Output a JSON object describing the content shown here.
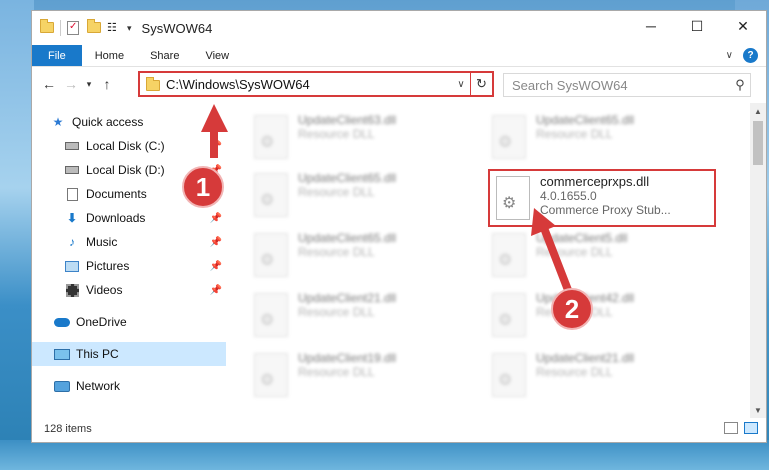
{
  "window": {
    "title": "SysWOW64"
  },
  "ribbon": {
    "tabs": [
      "File",
      "Home",
      "Share",
      "View"
    ]
  },
  "address": {
    "path": "C:\\Windows\\SysWOW64"
  },
  "search": {
    "placeholder": "Search SysWOW64"
  },
  "nav": {
    "items": [
      {
        "label": "Quick access",
        "icon": "star-icon"
      },
      {
        "label": "Local Disk (C:)",
        "icon": "drive-icon"
      },
      {
        "label": "Local Disk (D:)",
        "icon": "drive-icon"
      },
      {
        "label": "Documents",
        "icon": "documents-icon"
      },
      {
        "label": "Downloads",
        "icon": "downloads-icon"
      },
      {
        "label": "Music",
        "icon": "music-icon"
      },
      {
        "label": "Pictures",
        "icon": "pictures-icon"
      },
      {
        "label": "Videos",
        "icon": "videos-icon"
      },
      {
        "label": "OneDrive",
        "icon": "onedrive-icon"
      },
      {
        "label": "This PC",
        "icon": "this-pc-icon"
      },
      {
        "label": "Network",
        "icon": "network-icon"
      }
    ]
  },
  "files": {
    "background": [
      {
        "name": "UpdateClient63.dll",
        "type": "Resource DLL"
      },
      {
        "name": "UpdateClient65.dll",
        "type": "Resource DLL"
      },
      {
        "name": "UpdateClient65.dll",
        "type": "Resource DLL"
      },
      {
        "name": "UpdateClient65.dll",
        "type": "Resource DLL"
      },
      {
        "name": "UpdateClient5.dll",
        "type": "Resource DLL"
      },
      {
        "name": "UpdateClient21.dll",
        "type": "Resource DLL"
      },
      {
        "name": "UpdateClient42.dll",
        "type": "Resource DLL"
      },
      {
        "name": "UpdateClient19.dll",
        "type": "Resource DLL"
      },
      {
        "name": "UpdateClient21.dll",
        "type": "Resource DLL"
      }
    ],
    "featured": {
      "name": "commerceprxps.dll",
      "version": "4.0.1655.0",
      "description": "Commerce Proxy Stub..."
    }
  },
  "status": {
    "items_count": "128 items"
  },
  "callouts": {
    "one": "1",
    "two": "2"
  },
  "colors": {
    "accent": "#1979ca",
    "highlight": "#d63a3a",
    "selection": "#cce8ff"
  }
}
